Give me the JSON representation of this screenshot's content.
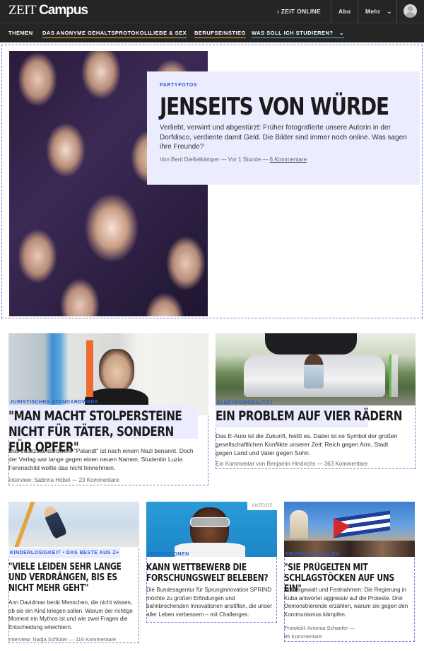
{
  "topbar": {
    "logo_zeit": "ZEIT",
    "logo_campus": "Campus",
    "zeit_online": "› ZEIT ONLINE",
    "abo": "Abo",
    "mehr": "Mehr",
    "mehr_chevron": "⌄"
  },
  "topics": {
    "label": "THEMEN",
    "items": [
      "DAS ANONYME GEHALTSPROTOKOLL",
      "LIEBE & SEX",
      "BERUFSEINSTIEG",
      "WAS SOLL ICH STUDIEREN?"
    ],
    "chevron": "⌄"
  },
  "hero": {
    "kicker": "PARTYFOTOS",
    "title": "JENSEITS VON WÜRDE",
    "teaser": "Verliebt, verwirrt und abgestürzt: Früher fotografierte unsere Autorin in der Dorfdisco, verdiente damit Geld. Die Bilder sind immer noch online. Was sagen ihre Freunde?",
    "meta_prefix": "Von Berit Dießelkämper — Vor 1 Stunde — ",
    "comments": "6 Kommentare"
  },
  "articles": [
    {
      "kicker": "JURISTISCHES STANDARDWERK",
      "title": "\"MAN MACHT STOLPERSTEINE NICHT FÜR TÄTER, SONDERN FÜR OPFER\"",
      "teaser": "Das Justizstandardwerk \"Palandt\" ist nach einem Nazi benannt. Doch der Verlag war lange gegen einen neuen Namen. Studentin Luzia Ferenschild wollte das nicht hinnehmen.",
      "meta": "Interview: Sabrina Höbel — 23 Kommentare"
    },
    {
      "kicker": "ELEKTROMOBILITÄT",
      "title": "EIN PROBLEM AUF VIER RÄDERN",
      "teaser": "Das E-Auto ist die Zukunft, heißt es. Dabei ist es Symbol der großen gesellschaftlichen Konflikte unserer Zeit: Reich gegen Arm, Stadt gegen Land und Vater gegen Sohn.",
      "meta": "Ein Kommentar von Benjamin Hindrichs — 363 Kommentare"
    },
    {
      "kicker": "KINDERLOSIGKEIT • DAS BESTE AUS Z+",
      "title": "\"VIELE LEIDEN SEHR LANGE UND VERDRÄNGEN, BIS ES NICHT MEHR GEHT\"",
      "teaser": "Ann Davidman berät Menschen, die nicht wissen, ob sie ein Kind kriegen sollen. Warum der richtige Moment ein Mythos ist und wie zwei Fragen die Entscheidung erleichtern.",
      "meta": "Interview: Nadja Schlüter — 116 Kommentare"
    },
    {
      "kicker": "INNOVATIONEN",
      "title": "KANN WETTBEWERB DIE FORSCHUNGSWELT BELEBEN?",
      "teaser": "Die Bundesagentur für Sprunginnovation SPRIND möchte zu großen Erfindungen und bahnbrechenden Innovationen anstiften, die unser aller Leben verbessern – mit Challenges.",
      "badge": "ANZEIGE"
    },
    {
      "kicker": "PROTESTE IN KUBA",
      "title": "\"SIE PRÜGELTEN MIT SCHLAGSTÖCKEN AUF UNS EIN\"",
      "teaser": "Polizeigewalt und Festnahmen: Die Regierung in Kuba antwortet aggressiv auf die Proteste. Drei Demonstrierende erzählen, warum sie gegen den Kommunismus kämpfen.",
      "meta_line1": "Protokoll: Antonia Schaefer —",
      "meta_line2": "95 Kommentare"
    }
  ]
}
